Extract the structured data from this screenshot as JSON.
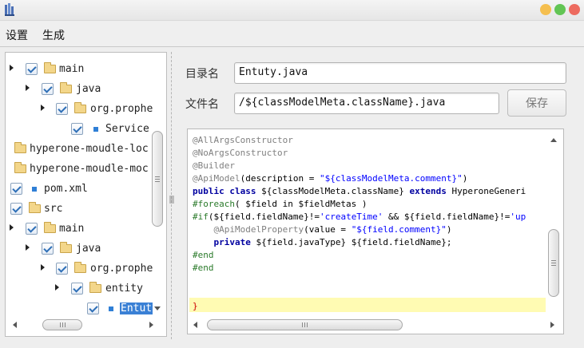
{
  "window": {
    "icon": "app-icon",
    "controls": [
      "minimize",
      "maximize",
      "close"
    ],
    "colors": {
      "minimize": "#f5bf4f",
      "maximize": "#62c554",
      "close": "#ed6b5f"
    }
  },
  "menu": {
    "items": [
      {
        "label": "设置"
      },
      {
        "label": "生成"
      }
    ]
  },
  "tree": {
    "selected": "Entut",
    "rows": [
      {
        "label": "main",
        "type": "folder",
        "expanded": true,
        "checked": true
      },
      {
        "label": "java",
        "type": "folder",
        "expanded": false,
        "checked": true
      },
      {
        "label": "org.prophe",
        "type": "folder",
        "expanded": false,
        "checked": true
      },
      {
        "label": "Service",
        "type": "file",
        "checked": true
      },
      {
        "label": "hyperone-moudle-loc",
        "type": "folder",
        "checked": false
      },
      {
        "label": "hyperone-moudle-moc",
        "type": "folder",
        "checked": false
      },
      {
        "label": "pom.xml",
        "type": "file",
        "checked": true
      },
      {
        "label": "src",
        "type": "folder",
        "checked": true
      },
      {
        "label": "main",
        "type": "folder",
        "expanded": false,
        "checked": true
      },
      {
        "label": "java",
        "type": "folder",
        "expanded": false,
        "checked": true
      },
      {
        "label": "org.prophe",
        "type": "folder",
        "expanded": false,
        "checked": true
      },
      {
        "label": "entity",
        "type": "folder",
        "expanded": false,
        "checked": true
      },
      {
        "label": "Entut",
        "type": "file",
        "checked": true,
        "selected": true
      }
    ]
  },
  "form": {
    "dir_label": "目录名",
    "dir_value": "Entuty.java",
    "file_label": "文件名",
    "file_value": "/${classModelMeta.className}.java",
    "save_label": "保存"
  },
  "code": {
    "lines": [
      [
        {
          "t": "@AllArgsConstructor",
          "c": "ann"
        }
      ],
      [
        {
          "t": "@NoArgsConstructor",
          "c": "ann"
        }
      ],
      [
        {
          "t": "@Builder",
          "c": "ann"
        }
      ],
      [
        {
          "t": "@ApiModel",
          "c": "ann"
        },
        {
          "t": "(description = ",
          "c": "plain"
        },
        {
          "t": "\"${classModelMeta.comment}\"",
          "c": "str"
        },
        {
          "t": ")",
          "c": "plain"
        }
      ],
      [
        {
          "t": "public class ",
          "c": "kw"
        },
        {
          "t": "${classModelMeta.className} ",
          "c": "var"
        },
        {
          "t": "extends ",
          "c": "kw"
        },
        {
          "t": "HyperoneGeneri",
          "c": "plain"
        }
      ],
      [
        {
          "t": "#foreach",
          "c": "vel"
        },
        {
          "t": "( $field in $fieldMetas )",
          "c": "plain"
        }
      ],
      [
        {
          "t": "#if",
          "c": "vel"
        },
        {
          "t": "(${field.fieldName}!=",
          "c": "plain"
        },
        {
          "t": "'createTime'",
          "c": "str"
        },
        {
          "t": " && ${field.fieldName}!=",
          "c": "plain"
        },
        {
          "t": "'up",
          "c": "str"
        }
      ],
      [
        {
          "t": "    @ApiModelProperty",
          "c": "ann"
        },
        {
          "t": "(value = ",
          "c": "plain"
        },
        {
          "t": "\"${field.comment}\"",
          "c": "str"
        },
        {
          "t": ")",
          "c": "plain"
        }
      ],
      [
        {
          "t": "    private ",
          "c": "kw"
        },
        {
          "t": "${field.javaType} ${field.fieldName};",
          "c": "plain"
        }
      ],
      [
        {
          "t": "#end",
          "c": "vel"
        }
      ],
      [
        {
          "t": "#end",
          "c": "vel"
        }
      ],
      [
        {
          "t": "",
          "c": "plain"
        }
      ],
      [
        {
          "t": "",
          "c": "plain"
        }
      ],
      [
        {
          "t": "}",
          "c": "brace"
        }
      ]
    ]
  }
}
